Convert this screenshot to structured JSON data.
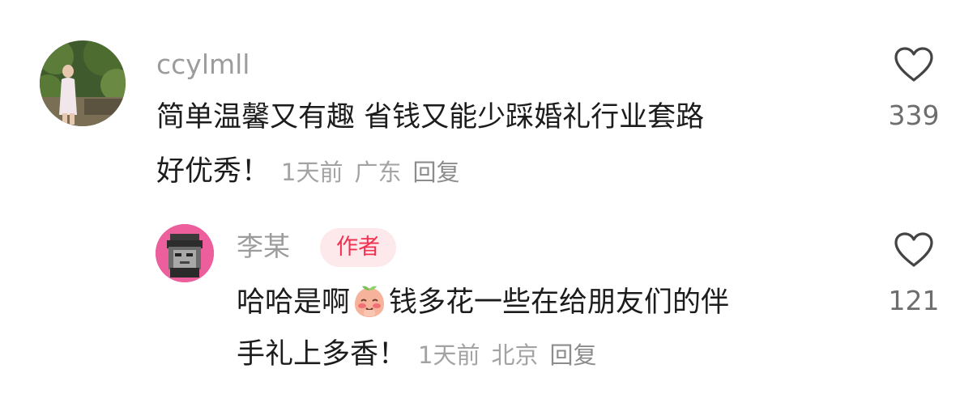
{
  "comments": [
    {
      "username": "ccylmll",
      "text_line1": "简单温馨又有趣 省钱又能少踩婚礼行业套路",
      "text_line2": "好优秀！",
      "time": "1天前",
      "location": "广东",
      "reply_label": "回复",
      "like_count": "339",
      "avatar_icon": "user-photo-avatar"
    },
    {
      "username": "李某",
      "badge": "作者",
      "text_line1_part1": "哈哈是啊",
      "emoji_icon": "blushing-peach-emoji",
      "text_line1_part2": "钱多花一些在给朋友们的伴",
      "text_line2": "手礼上多香！",
      "time": "1天前",
      "location": "北京",
      "reply_label": "回复",
      "like_count": "121",
      "avatar_icon": "pixel-art-avatar"
    }
  ],
  "colors": {
    "username": "#9c9c9c",
    "text": "#1c1c1c",
    "meta": "#a3a3a3",
    "badge_bg": "#fde9ec",
    "badge_text": "#f0304f",
    "avatar2_bg": "#ec5e9c"
  }
}
